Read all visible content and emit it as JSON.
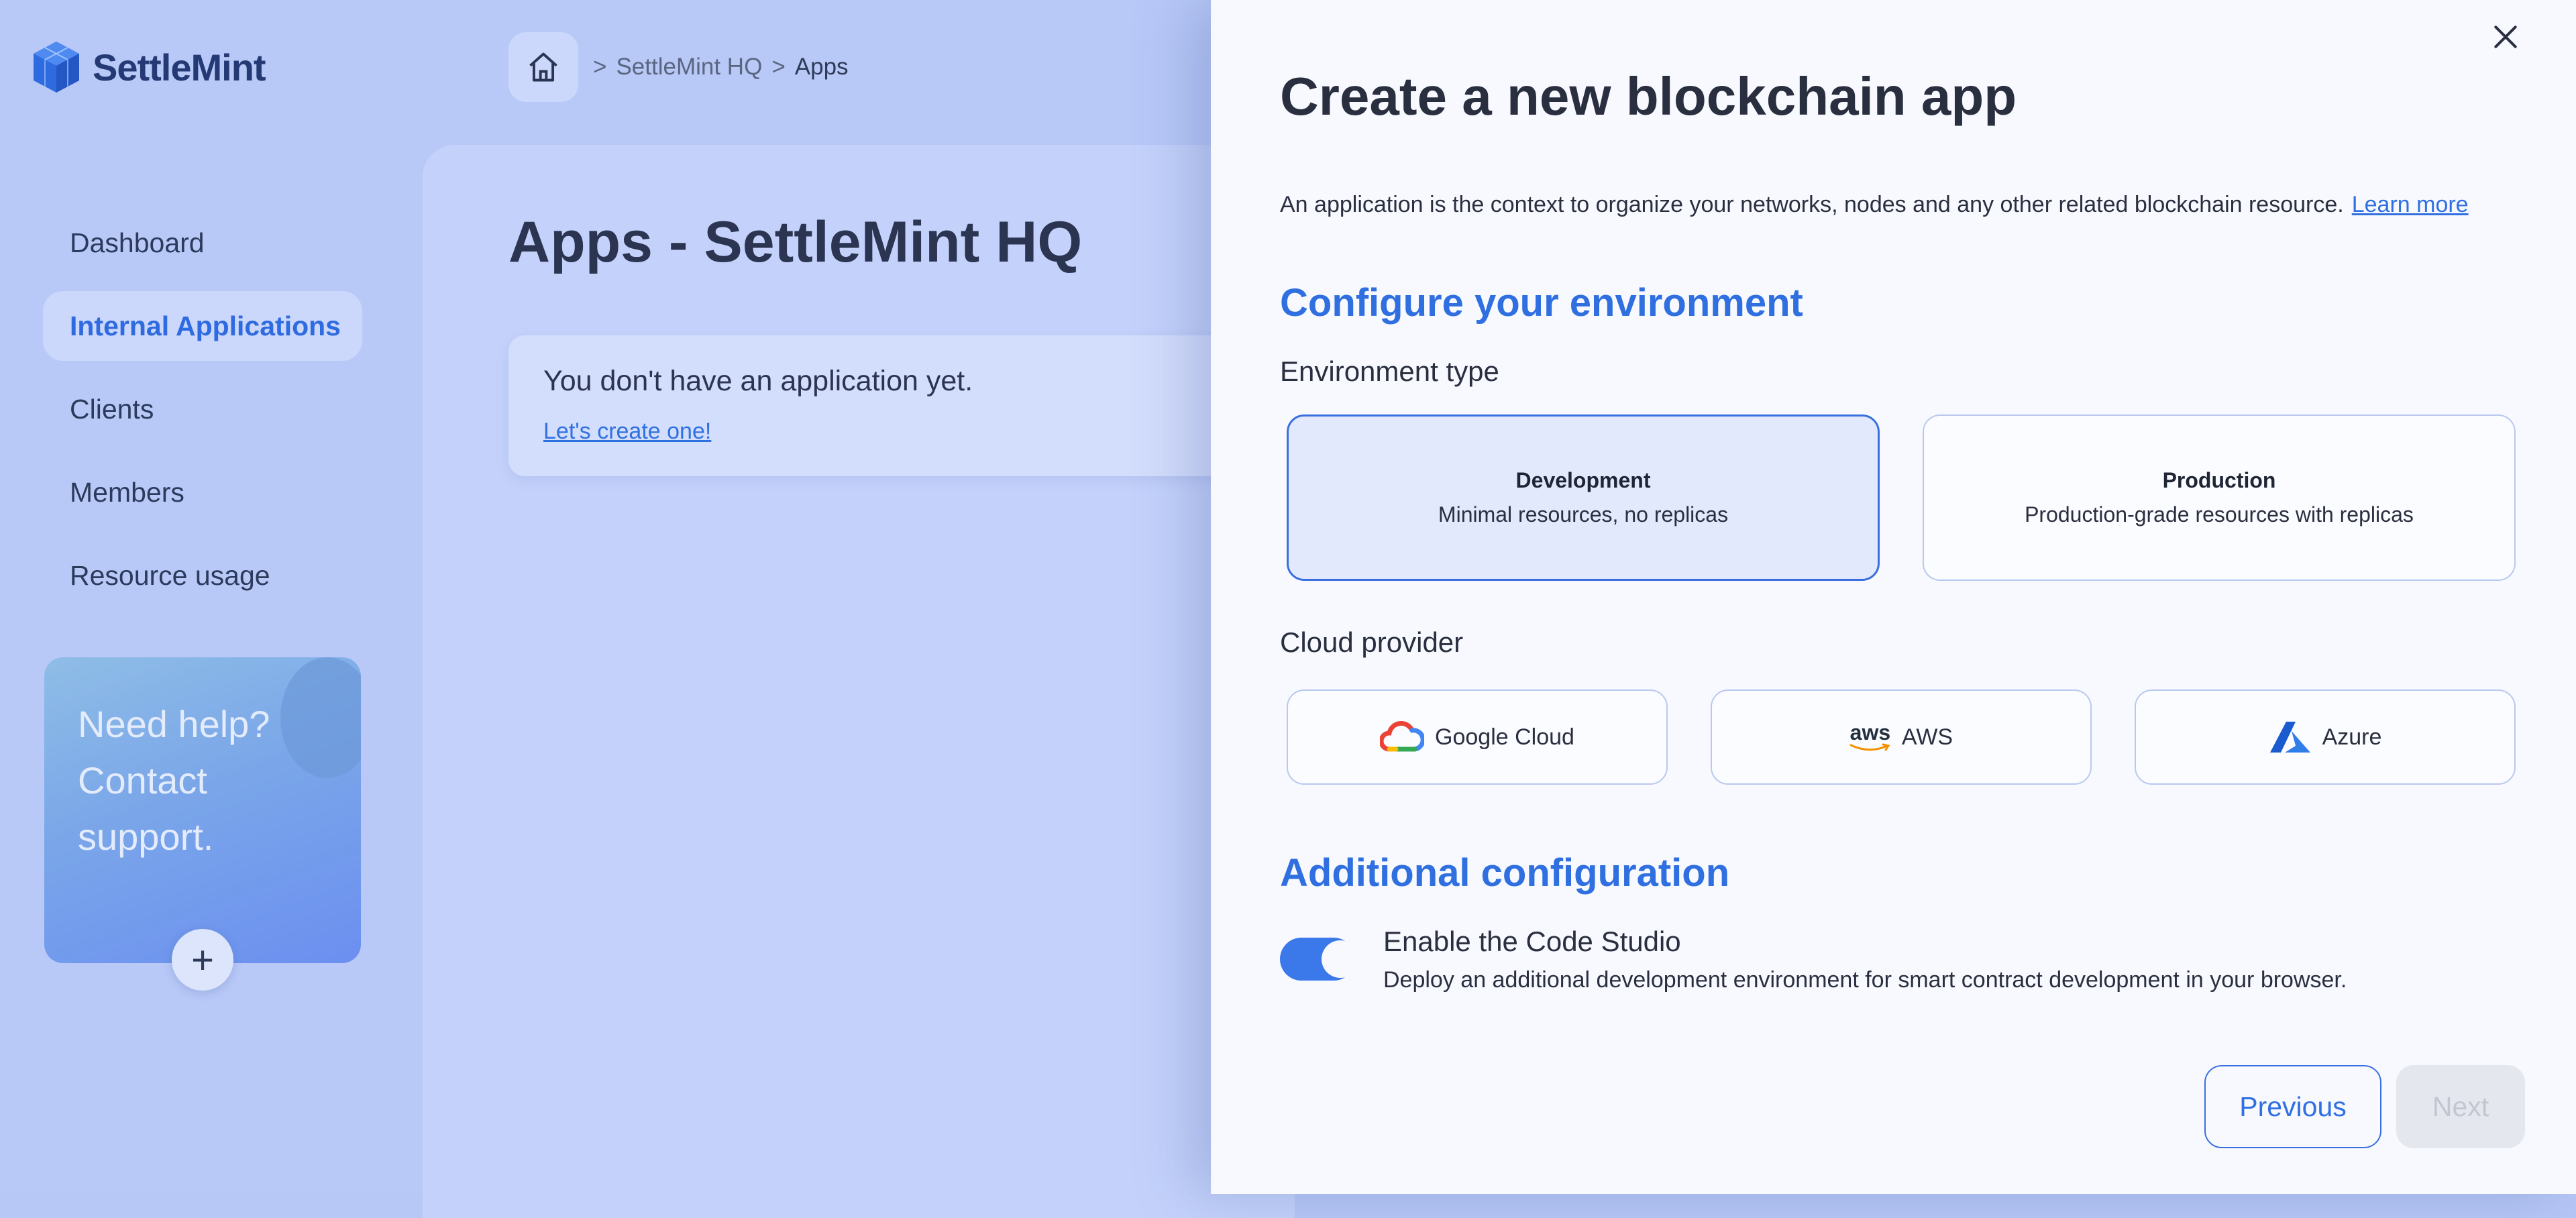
{
  "brand": {
    "name": "SettleMint"
  },
  "sidebar": {
    "items": [
      {
        "label": "Dashboard"
      },
      {
        "label": "Internal Applications"
      },
      {
        "label": "Clients"
      },
      {
        "label": "Members"
      },
      {
        "label": "Resource usage"
      }
    ],
    "active_index": 1,
    "help": {
      "text": "Need help? Contact support.",
      "plus": "+"
    }
  },
  "breadcrumb": {
    "sep": ">",
    "workspace": "SettleMint HQ",
    "current": "Apps"
  },
  "main": {
    "title": "Apps - SettleMint HQ",
    "empty_title": "You don't have an application yet.",
    "empty_link": "Let's create one!"
  },
  "drawer": {
    "title": "Create a new blockchain app",
    "description": "An application is the context to organize your networks, nodes and any other related blockchain resource.",
    "learn_more": "Learn more",
    "configure_heading": "Configure your environment",
    "env_label": "Environment type",
    "env_options": [
      {
        "title": "Development",
        "subtitle": "Minimal resources, no replicas",
        "selected": true
      },
      {
        "title": "Production",
        "subtitle": "Production-grade resources with replicas",
        "selected": false
      }
    ],
    "cloud_label": "Cloud provider",
    "cloud_options": [
      {
        "label": "Google Cloud",
        "icon": "google-cloud-icon"
      },
      {
        "label": "AWS",
        "icon": "aws-icon",
        "icon_text": "aws"
      },
      {
        "label": "Azure",
        "icon": "azure-icon"
      }
    ],
    "additional_heading": "Additional configuration",
    "code_studio": {
      "title": "Enable the Code Studio",
      "description": "Deploy an additional development environment for smart contract development in your browser.",
      "enabled": true
    },
    "buttons": {
      "previous": "Previous",
      "next": "Next"
    }
  },
  "colors": {
    "accent": "#2f6fe0",
    "page_bg": "#b8c9f8",
    "drawer_bg": "#f7f9ff"
  }
}
